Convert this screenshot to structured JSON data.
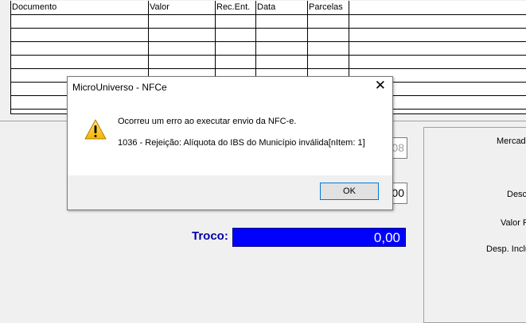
{
  "grid": {
    "headers": [
      "Documento",
      "Valor",
      "Rec.Ent.",
      "Data",
      "Parcelas"
    ]
  },
  "left": {
    "field1_value": "08",
    "field2_value": "00",
    "troco_label": "Troco:",
    "troco_value": "0,00"
  },
  "right": {
    "label1": "Mercado",
    "label2": "Desco",
    "label3": "Valor F",
    "label4": "Desp. Inclu"
  },
  "dialog": {
    "title": "MicroUniverso - NFCe",
    "close_glyph": "✕",
    "message_line1": "Ocorreu um erro ao executar envio da NFC-e.",
    "message_line2": "1036 - Rejeição: Alíquota do IBS do Município inválida[nItem: 1]",
    "ok_label": "OK",
    "icon": "warning-icon"
  },
  "colors": {
    "troco_bg": "#0000ff",
    "troco_label": "#0000a8",
    "ok_border": "#0078d7"
  }
}
